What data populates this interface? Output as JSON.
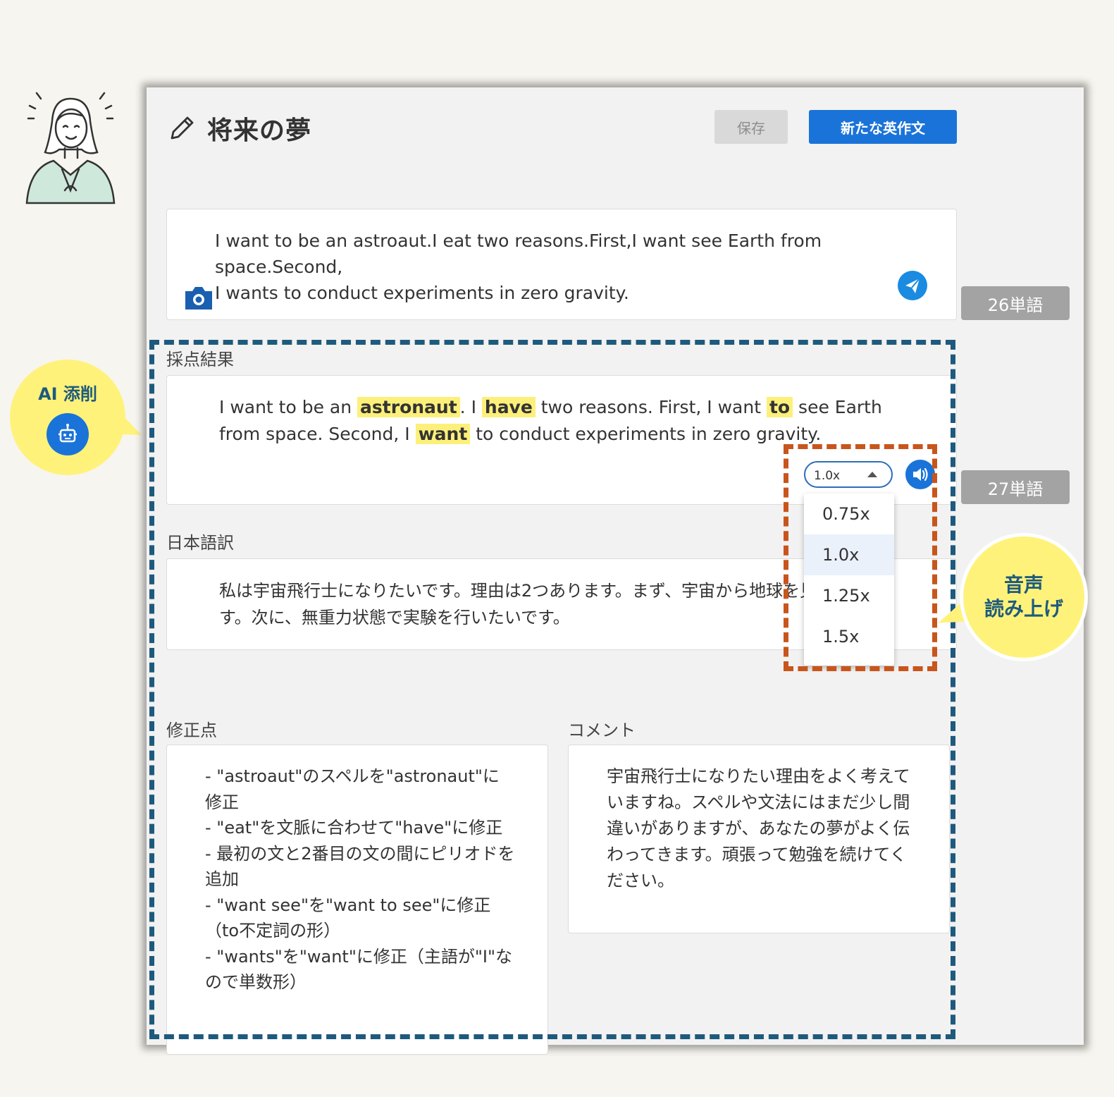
{
  "header": {
    "title": "将来の夢",
    "save_label": "保存",
    "new_label": "新たな英作文"
  },
  "input": {
    "text_line1": "I want to be an astroaut.I eat two reasons.First,I want see Earth from space.Second,",
    "text_line2": "I wants to conduct experiments in zero gravity.",
    "word_count": "26単語"
  },
  "result": {
    "label": "採点結果",
    "segments": [
      {
        "text": "I want to be an ",
        "hl": false
      },
      {
        "text": "astronaut",
        "hl": true
      },
      {
        "text": ". I ",
        "hl": false
      },
      {
        "text": "have",
        "hl": true
      },
      {
        "text": " two reasons. First, I want ",
        "hl": false
      },
      {
        "text": "to",
        "hl": true
      },
      {
        "text": " see Earth from space. Second, I ",
        "hl": false
      },
      {
        "text": "want",
        "hl": true
      },
      {
        "text": " to conduct experiments in zero gravity.",
        "hl": false
      }
    ],
    "word_count": "27単語"
  },
  "translation": {
    "label": "日本語訳",
    "text": "私は宇宙飛行士になりたいです。理由は2つあります。まず、宇宙から地球を見たいです。次に、無重力状態で実験を行いたいです。"
  },
  "corrections": {
    "label": "修正点",
    "items": [
      "- \"astroaut\"のスペルを\"astronaut\"に修正",
      "- \"eat\"を文脈に合わせて\"have\"に修正",
      "- 最初の文と2番目の文の間にピリオドを追加",
      "- \"want see\"を\"want to see\"に修正（to不定詞の形）",
      "- \"wants\"を\"want\"に修正（主語が\"I\"なので単数形）"
    ]
  },
  "comment": {
    "label": "コメント",
    "text": "宇宙飛行士になりたい理由をよく考えていますね。スペルや文法にはまだ少し間違いがありますが、あなたの夢がよく伝わってきます。頑張って勉強を続けてください。"
  },
  "speed": {
    "selected": "1.0x",
    "options": [
      "0.75x",
      "1.0x",
      "1.25x",
      "1.5x"
    ]
  },
  "callouts": {
    "ai": "AI 添削",
    "voice_line1": "音声",
    "voice_line2": "読み上げ"
  },
  "colors": {
    "accent": "#1a73d8",
    "highlight": "#fdf07a",
    "callout": "#fff27a",
    "blue_frame": "#1e5a7d",
    "orange_frame": "#c8551c"
  },
  "icons": [
    "pencil-icon",
    "camera-icon",
    "send-icon",
    "speaker-icon",
    "robot-icon",
    "teacher-illustration"
  ]
}
